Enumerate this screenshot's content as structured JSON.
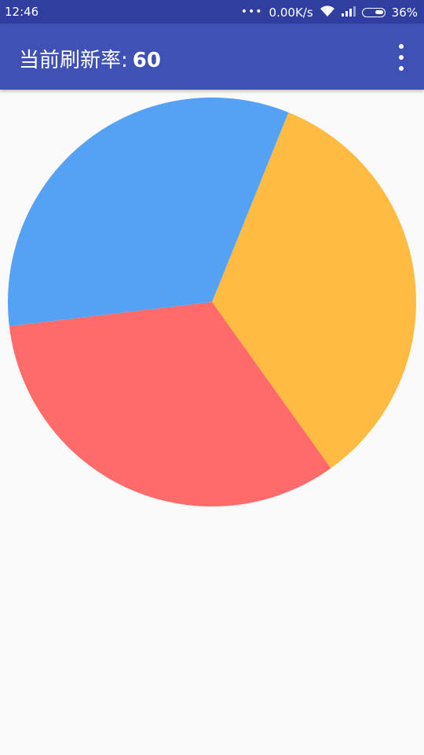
{
  "status_bar": {
    "time": "12:46",
    "dots": "•••",
    "network_speed": "0.00K/s",
    "battery": "36%",
    "icons": [
      "wifi-icon",
      "signal-icon",
      "battery-icon"
    ]
  },
  "app_bar": {
    "title": "当前刷新率:",
    "refresh_rate": "60",
    "menu_icon": "more-vert-icon"
  },
  "chart_data": {
    "type": "pie",
    "slices": [
      {
        "value": 34,
        "color": "#ffbb42"
      },
      {
        "value": 33,
        "color": "#ff6b6b"
      },
      {
        "value": 33,
        "color": "#55a2f5"
      }
    ],
    "start_angle_deg": -68
  }
}
